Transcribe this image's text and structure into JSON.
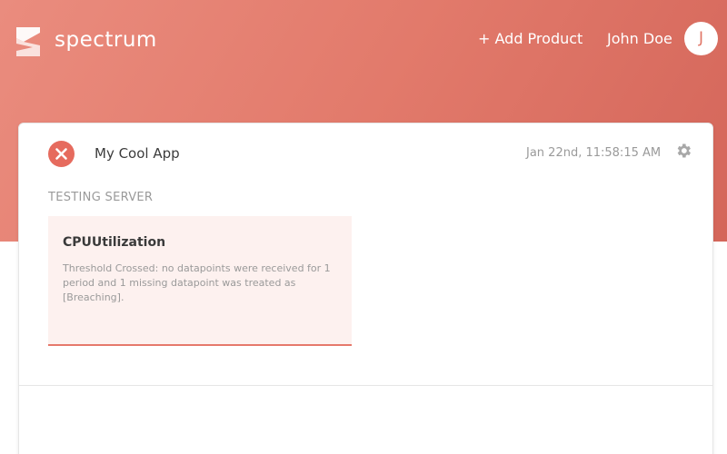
{
  "header": {
    "brand": "spectrum",
    "add_product": "+ Add Product",
    "user_name": "John Doe",
    "avatar_initial": "J",
    "logo_icon": "spectrum-logo-icon"
  },
  "app_card": {
    "status_icon": "error-x-icon",
    "app_name": "My Cool App",
    "timestamp": "Jan 22nd, 11:58:15 AM",
    "settings_icon": "gear-icon",
    "server_label": "TESTING SERVER",
    "alert": {
      "title": "CPUUtilization",
      "message": "Threshold Crossed: no datapoints were received for 1 period and 1 missing datapoint was treated as [Breaching]."
    }
  },
  "colors": {
    "accent": "#e27a6b",
    "error": "#e66b5e",
    "alert_bg": "#fdf1ef"
  }
}
